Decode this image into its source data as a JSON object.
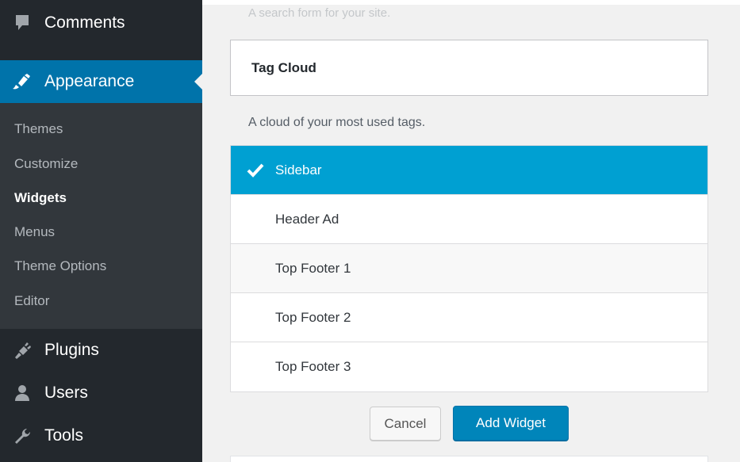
{
  "sidebar": {
    "top_items": {
      "comments": {
        "label": "Comments",
        "icon": "comment-icon"
      },
      "appearance": {
        "label": "Appearance",
        "icon": "paintbrush-icon"
      },
      "plugins": {
        "label": "Plugins",
        "icon": "plug-icon"
      },
      "users": {
        "label": "Users",
        "icon": "user-icon"
      },
      "tools": {
        "label": "Tools",
        "icon": "wrench-icon"
      }
    },
    "submenu": [
      "Themes",
      "Customize",
      "Widgets",
      "Menus",
      "Theme Options",
      "Editor"
    ],
    "current_submenu": "Widgets"
  },
  "main": {
    "previous_widget_description": "A search form for your site.",
    "widget": {
      "title": "Tag Cloud",
      "description": "A cloud of your most used tags."
    },
    "sidebar_choices": [
      {
        "label": "Sidebar",
        "selected": true
      },
      {
        "label": "Header Ad",
        "selected": false
      },
      {
        "label": "Top Footer 1",
        "selected": false
      },
      {
        "label": "Top Footer 2",
        "selected": false
      },
      {
        "label": "Top Footer 3",
        "selected": false
      }
    ],
    "buttons": {
      "cancel": "Cancel",
      "add": "Add Widget"
    }
  },
  "colors": {
    "sidebar_bg": "#23282d",
    "submenu_bg": "#32373c",
    "accent": "#0073aa",
    "selected_row": "#00a0d2",
    "primary_button": "#0085ba"
  }
}
